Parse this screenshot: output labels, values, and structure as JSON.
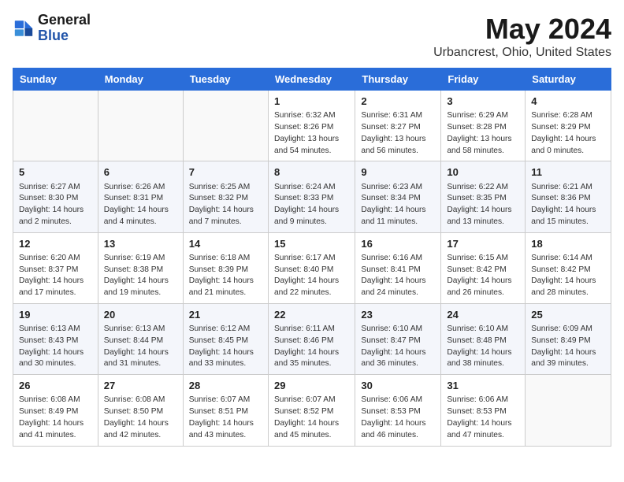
{
  "header": {
    "logo_line1": "General",
    "logo_line2": "Blue",
    "main_title": "May 2024",
    "subtitle": "Urbancrest, Ohio, United States"
  },
  "days_of_week": [
    "Sunday",
    "Monday",
    "Tuesday",
    "Wednesday",
    "Thursday",
    "Friday",
    "Saturday"
  ],
  "weeks": [
    [
      {
        "day": "",
        "info": ""
      },
      {
        "day": "",
        "info": ""
      },
      {
        "day": "",
        "info": ""
      },
      {
        "day": "1",
        "info": "Sunrise: 6:32 AM\nSunset: 8:26 PM\nDaylight: 13 hours and 54 minutes."
      },
      {
        "day": "2",
        "info": "Sunrise: 6:31 AM\nSunset: 8:27 PM\nDaylight: 13 hours and 56 minutes."
      },
      {
        "day": "3",
        "info": "Sunrise: 6:29 AM\nSunset: 8:28 PM\nDaylight: 13 hours and 58 minutes."
      },
      {
        "day": "4",
        "info": "Sunrise: 6:28 AM\nSunset: 8:29 PM\nDaylight: 14 hours and 0 minutes."
      }
    ],
    [
      {
        "day": "5",
        "info": "Sunrise: 6:27 AM\nSunset: 8:30 PM\nDaylight: 14 hours and 2 minutes."
      },
      {
        "day": "6",
        "info": "Sunrise: 6:26 AM\nSunset: 8:31 PM\nDaylight: 14 hours and 4 minutes."
      },
      {
        "day": "7",
        "info": "Sunrise: 6:25 AM\nSunset: 8:32 PM\nDaylight: 14 hours and 7 minutes."
      },
      {
        "day": "8",
        "info": "Sunrise: 6:24 AM\nSunset: 8:33 PM\nDaylight: 14 hours and 9 minutes."
      },
      {
        "day": "9",
        "info": "Sunrise: 6:23 AM\nSunset: 8:34 PM\nDaylight: 14 hours and 11 minutes."
      },
      {
        "day": "10",
        "info": "Sunrise: 6:22 AM\nSunset: 8:35 PM\nDaylight: 14 hours and 13 minutes."
      },
      {
        "day": "11",
        "info": "Sunrise: 6:21 AM\nSunset: 8:36 PM\nDaylight: 14 hours and 15 minutes."
      }
    ],
    [
      {
        "day": "12",
        "info": "Sunrise: 6:20 AM\nSunset: 8:37 PM\nDaylight: 14 hours and 17 minutes."
      },
      {
        "day": "13",
        "info": "Sunrise: 6:19 AM\nSunset: 8:38 PM\nDaylight: 14 hours and 19 minutes."
      },
      {
        "day": "14",
        "info": "Sunrise: 6:18 AM\nSunset: 8:39 PM\nDaylight: 14 hours and 21 minutes."
      },
      {
        "day": "15",
        "info": "Sunrise: 6:17 AM\nSunset: 8:40 PM\nDaylight: 14 hours and 22 minutes."
      },
      {
        "day": "16",
        "info": "Sunrise: 6:16 AM\nSunset: 8:41 PM\nDaylight: 14 hours and 24 minutes."
      },
      {
        "day": "17",
        "info": "Sunrise: 6:15 AM\nSunset: 8:42 PM\nDaylight: 14 hours and 26 minutes."
      },
      {
        "day": "18",
        "info": "Sunrise: 6:14 AM\nSunset: 8:42 PM\nDaylight: 14 hours and 28 minutes."
      }
    ],
    [
      {
        "day": "19",
        "info": "Sunrise: 6:13 AM\nSunset: 8:43 PM\nDaylight: 14 hours and 30 minutes."
      },
      {
        "day": "20",
        "info": "Sunrise: 6:13 AM\nSunset: 8:44 PM\nDaylight: 14 hours and 31 minutes."
      },
      {
        "day": "21",
        "info": "Sunrise: 6:12 AM\nSunset: 8:45 PM\nDaylight: 14 hours and 33 minutes."
      },
      {
        "day": "22",
        "info": "Sunrise: 6:11 AM\nSunset: 8:46 PM\nDaylight: 14 hours and 35 minutes."
      },
      {
        "day": "23",
        "info": "Sunrise: 6:10 AM\nSunset: 8:47 PM\nDaylight: 14 hours and 36 minutes."
      },
      {
        "day": "24",
        "info": "Sunrise: 6:10 AM\nSunset: 8:48 PM\nDaylight: 14 hours and 38 minutes."
      },
      {
        "day": "25",
        "info": "Sunrise: 6:09 AM\nSunset: 8:49 PM\nDaylight: 14 hours and 39 minutes."
      }
    ],
    [
      {
        "day": "26",
        "info": "Sunrise: 6:08 AM\nSunset: 8:49 PM\nDaylight: 14 hours and 41 minutes."
      },
      {
        "day": "27",
        "info": "Sunrise: 6:08 AM\nSunset: 8:50 PM\nDaylight: 14 hours and 42 minutes."
      },
      {
        "day": "28",
        "info": "Sunrise: 6:07 AM\nSunset: 8:51 PM\nDaylight: 14 hours and 43 minutes."
      },
      {
        "day": "29",
        "info": "Sunrise: 6:07 AM\nSunset: 8:52 PM\nDaylight: 14 hours and 45 minutes."
      },
      {
        "day": "30",
        "info": "Sunrise: 6:06 AM\nSunset: 8:53 PM\nDaylight: 14 hours and 46 minutes."
      },
      {
        "day": "31",
        "info": "Sunrise: 6:06 AM\nSunset: 8:53 PM\nDaylight: 14 hours and 47 minutes."
      },
      {
        "day": "",
        "info": ""
      }
    ]
  ]
}
